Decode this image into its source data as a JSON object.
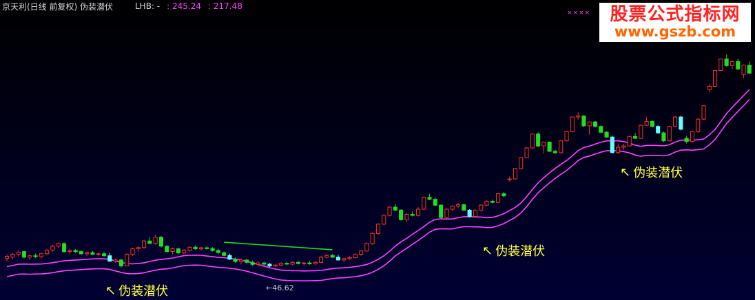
{
  "header": {
    "title": "京天利(日线 前复权) 伪装潜伏",
    "indicator_label": "LHB: -",
    "value1": ": 245.24",
    "value2": ": 217.48"
  },
  "watermark": {
    "site_name": "股票公式指标网",
    "url": "www.gszb.com"
  },
  "markers": "××××",
  "annotations": [
    {
      "text": "伪装潜伏",
      "arrow": "↖"
    },
    {
      "text": "伪装潜伏",
      "arrow": "↖"
    },
    {
      "text": "伪装潜伏",
      "arrow": "↖"
    }
  ],
  "low_label": "←46.62",
  "colors": {
    "up_candle": "#ff3030",
    "down_candle": "#22dd22",
    "signal_candle": "#66ffff",
    "band_line": "#ff44ff",
    "green_line": "#22dd22",
    "annotation": "#ffff44"
  },
  "chart_data": {
    "type": "candlestick",
    "note_scale": "price",
    "price_min": 40,
    "price_max": 250,
    "candles": [
      {
        "o": 49.5,
        "h": 51.0,
        "l": 48.5,
        "c": 50.3
      },
      {
        "o": 50.0,
        "h": 51.5,
        "l": 49.2,
        "c": 51.0
      },
      {
        "o": 51.0,
        "h": 52.5,
        "l": 50.3,
        "c": 51.8
      },
      {
        "o": 52.0,
        "h": 52.3,
        "l": 49.5,
        "c": 50.0
      },
      {
        "o": 50.0,
        "h": 51.0,
        "l": 49.0,
        "c": 50.5
      },
      {
        "o": 50.5,
        "h": 51.3,
        "l": 49.7,
        "c": 50.2
      },
      {
        "o": 50.2,
        "h": 51.5,
        "l": 49.5,
        "c": 51.2
      },
      {
        "o": 51.2,
        "h": 53.0,
        "l": 50.8,
        "c": 52.5
      },
      {
        "o": 52.5,
        "h": 54.5,
        "l": 52.0,
        "c": 54.0
      },
      {
        "o": 54.0,
        "h": 55.5,
        "l": 53.3,
        "c": 55.0
      },
      {
        "o": 55.0,
        "h": 55.5,
        "l": 51.5,
        "c": 52.0
      },
      {
        "o": 52.0,
        "h": 53.0,
        "l": 51.0,
        "c": 52.4
      },
      {
        "o": 52.4,
        "h": 53.0,
        "l": 51.5,
        "c": 52.0
      },
      {
        "o": 52.0,
        "h": 52.5,
        "l": 50.8,
        "c": 51.2
      },
      {
        "o": 51.2,
        "h": 52.0,
        "l": 50.5,
        "c": 51.6
      },
      {
        "o": 51.6,
        "h": 52.2,
        "l": 50.8,
        "c": 51.0
      },
      {
        "o": 51.0,
        "h": 51.6,
        "l": 50.3,
        "c": 51.2
      },
      {
        "o": 51.2,
        "h": 51.8,
        "l": 50.2,
        "c": 50.5
      },
      {
        "o": 50.5,
        "h": 51.5,
        "l": 49.8,
        "c": 48.6,
        "sig": true
      },
      {
        "o": 48.6,
        "h": 49.5,
        "l": 48.0,
        "c": 49.0
      },
      {
        "o": 49.0,
        "h": 49.5,
        "l": 46.5,
        "c": 47.0
      },
      {
        "o": 47.0,
        "h": 51.5,
        "l": 47.0,
        "c": 51.0
      },
      {
        "o": 51.0,
        "h": 53.5,
        "l": 50.5,
        "c": 53.0
      },
      {
        "o": 53.0,
        "h": 54.0,
        "l": 52.0,
        "c": 53.5
      },
      {
        "o": 53.5,
        "h": 56.5,
        "l": 53.0,
        "c": 56.0
      },
      {
        "o": 56.0,
        "h": 57.5,
        "l": 55.5,
        "c": 55.0
      },
      {
        "o": 55.0,
        "h": 58.5,
        "l": 54.5,
        "c": 57.5
      },
      {
        "o": 57.5,
        "h": 58.0,
        "l": 53.5,
        "c": 54.0
      },
      {
        "o": 54.0,
        "h": 54.5,
        "l": 51.5,
        "c": 52.0
      },
      {
        "o": 52.0,
        "h": 53.5,
        "l": 51.0,
        "c": 53.0
      },
      {
        "o": 53.0,
        "h": 53.5,
        "l": 51.0,
        "c": 51.5
      },
      {
        "o": 51.5,
        "h": 53.0,
        "l": 51.0,
        "c": 52.5
      },
      {
        "o": 52.5,
        "h": 54.0,
        "l": 52.0,
        "c": 53.6
      },
      {
        "o": 53.6,
        "h": 54.2,
        "l": 52.6,
        "c": 53.0
      },
      {
        "o": 53.0,
        "h": 53.8,
        "l": 52.3,
        "c": 53.4
      },
      {
        "o": 53.4,
        "h": 54.0,
        "l": 52.7,
        "c": 53.1
      },
      {
        "o": 53.1,
        "h": 53.6,
        "l": 52.0,
        "c": 52.4
      },
      {
        "o": 52.4,
        "h": 53.0,
        "l": 51.2,
        "c": 51.6
      },
      {
        "o": 51.6,
        "h": 52.0,
        "l": 50.3,
        "c": 50.6
      },
      {
        "o": 50.6,
        "h": 51.2,
        "l": 49.0,
        "c": 49.3,
        "sig": true
      },
      {
        "o": 49.3,
        "h": 50.0,
        "l": 48.0,
        "c": 48.5
      },
      {
        "o": 48.5,
        "h": 49.5,
        "l": 47.5,
        "c": 49.0
      },
      {
        "o": 49.0,
        "h": 49.5,
        "l": 47.8,
        "c": 48.2
      },
      {
        "o": 48.2,
        "h": 48.8,
        "l": 47.0,
        "c": 47.5
      },
      {
        "o": 47.5,
        "h": 48.5,
        "l": 46.8,
        "c": 48.0
      },
      {
        "o": 48.0,
        "h": 48.5,
        "l": 47.2,
        "c": 47.6
      },
      {
        "o": 47.6,
        "h": 48.0,
        "l": 46.6,
        "c": 47.0,
        "sig": true
      },
      {
        "o": 47.0,
        "h": 47.5,
        "l": 46.62,
        "c": 47.3
      },
      {
        "o": 47.3,
        "h": 48.2,
        "l": 47.0,
        "c": 47.9
      },
      {
        "o": 47.9,
        "h": 48.5,
        "l": 47.3,
        "c": 47.6
      },
      {
        "o": 47.6,
        "h": 48.5,
        "l": 47.2,
        "c": 48.2
      },
      {
        "o": 48.2,
        "h": 48.8,
        "l": 47.5,
        "c": 47.8
      },
      {
        "o": 47.8,
        "h": 48.4,
        "l": 47.2,
        "c": 48.0
      },
      {
        "o": 48.0,
        "h": 48.6,
        "l": 47.4,
        "c": 47.7
      },
      {
        "o": 47.7,
        "h": 48.5,
        "l": 47.3,
        "c": 48.2
      },
      {
        "o": 48.2,
        "h": 50.5,
        "l": 48.0,
        "c": 50.0
      },
      {
        "o": 50.0,
        "h": 51.0,
        "l": 49.5,
        "c": 50.6
      },
      {
        "o": 50.6,
        "h": 51.2,
        "l": 49.7,
        "c": 50.0
      },
      {
        "o": 50.0,
        "h": 50.8,
        "l": 48.8,
        "c": 49.0,
        "sig": true
      },
      {
        "o": 49.0,
        "h": 49.8,
        "l": 48.2,
        "c": 49.5
      },
      {
        "o": 49.5,
        "h": 50.3,
        "l": 49.0,
        "c": 49.8
      },
      {
        "o": 49.8,
        "h": 51.5,
        "l": 49.5,
        "c": 51.0
      },
      {
        "o": 51.0,
        "h": 52.5,
        "l": 50.5,
        "c": 52.2
      },
      {
        "o": 52.2,
        "h": 55.5,
        "l": 52.0,
        "c": 55.0
      },
      {
        "o": 55.0,
        "h": 59.5,
        "l": 54.5,
        "c": 59.0
      },
      {
        "o": 59.0,
        "h": 63.5,
        "l": 58.5,
        "c": 63.0
      },
      {
        "o": 63.0,
        "h": 67.5,
        "l": 62.5,
        "c": 67.0
      },
      {
        "o": 67.0,
        "h": 71.5,
        "l": 66.5,
        "c": 71.0
      },
      {
        "o": 71.0,
        "h": 72.5,
        "l": 69.0,
        "c": 69.5
      },
      {
        "o": 69.5,
        "h": 70.0,
        "l": 64.5,
        "c": 65.0
      },
      {
        "o": 65.0,
        "h": 68.0,
        "l": 64.0,
        "c": 67.5
      },
      {
        "o": 67.5,
        "h": 69.0,
        "l": 66.5,
        "c": 67.0
      },
      {
        "o": 67.0,
        "h": 71.0,
        "l": 66.5,
        "c": 70.0
      },
      {
        "o": 70.0,
        "h": 76.5,
        "l": 69.5,
        "c": 76.0
      },
      {
        "o": 76.0,
        "h": 78.0,
        "l": 74.5,
        "c": 75.0
      },
      {
        "o": 75.0,
        "h": 76.0,
        "l": 71.5,
        "c": 72.0
      },
      {
        "o": 72.0,
        "h": 72.5,
        "l": 65.5,
        "c": 66.0
      },
      {
        "o": 66.0,
        "h": 70.5,
        "l": 65.5,
        "c": 70.0
      },
      {
        "o": 70.0,
        "h": 72.0,
        "l": 69.0,
        "c": 71.5
      },
      {
        "o": 71.5,
        "h": 73.0,
        "l": 70.5,
        "c": 72.2
      },
      {
        "o": 72.2,
        "h": 72.8,
        "l": 69.0,
        "c": 69.5
      },
      {
        "o": 69.5,
        "h": 70.0,
        "l": 66.0,
        "c": 66.5,
        "sig": true
      },
      {
        "o": 66.5,
        "h": 70.0,
        "l": 66.0,
        "c": 69.5
      },
      {
        "o": 69.5,
        "h": 72.5,
        "l": 68.8,
        "c": 72.0
      },
      {
        "o": 72.0,
        "h": 74.5,
        "l": 71.5,
        "c": 74.0
      },
      {
        "o": 74.0,
        "h": 75.0,
        "l": 73.0,
        "c": 73.4
      },
      {
        "o": 73.4,
        "h": 78.5,
        "l": 73.0,
        "c": 78.0
      },
      {
        "o": 78.0,
        "h": 79.0,
        "l": 76.0,
        "c": 76.8
      },
      {
        "o": 86.0,
        "h": 88.0,
        "l": 85.0,
        "c": 86.5
      },
      {
        "o": 86.5,
        "h": 93.5,
        "l": 86.0,
        "c": 93.0
      },
      {
        "o": 93.0,
        "h": 101.0,
        "l": 92.5,
        "c": 100.5
      },
      {
        "o": 100.5,
        "h": 108.0,
        "l": 100.0,
        "c": 107.5
      },
      {
        "o": 107.5,
        "h": 119.0,
        "l": 107.0,
        "c": 118.5
      },
      {
        "o": 118.5,
        "h": 120.0,
        "l": 108.0,
        "c": 109.0
      },
      {
        "o": 109.0,
        "h": 112.5,
        "l": 103.5,
        "c": 112.0
      },
      {
        "o": 112.0,
        "h": 112.5,
        "l": 104.5,
        "c": 105.0
      },
      {
        "o": 105.0,
        "h": 106.0,
        "l": 103.0,
        "c": 104.0
      },
      {
        "o": 104.0,
        "h": 113.5,
        "l": 103.5,
        "c": 113.0
      },
      {
        "o": 113.0,
        "h": 121.0,
        "l": 112.5,
        "c": 120.5
      },
      {
        "o": 120.5,
        "h": 134.0,
        "l": 120.0,
        "c": 133.5
      },
      {
        "o": 133.5,
        "h": 138.0,
        "l": 131.0,
        "c": 134.5
      },
      {
        "o": 134.5,
        "h": 135.0,
        "l": 124.5,
        "c": 125.5
      },
      {
        "o": 125.5,
        "h": 129.5,
        "l": 118.0,
        "c": 129.0
      },
      {
        "o": 129.0,
        "h": 130.0,
        "l": 124.0,
        "c": 125.0
      },
      {
        "o": 125.0,
        "h": 126.0,
        "l": 119.0,
        "c": 120.0
      },
      {
        "o": 120.0,
        "h": 121.0,
        "l": 115.5,
        "c": 116.0
      },
      {
        "o": 116.0,
        "h": 117.0,
        "l": 103.5,
        "c": 104.0,
        "sig": true
      },
      {
        "o": 104.0,
        "h": 111.0,
        "l": 103.0,
        "c": 108.0
      },
      {
        "o": 108.0,
        "h": 110.5,
        "l": 106.0,
        "c": 109.0
      },
      {
        "o": 109.0,
        "h": 117.0,
        "l": 108.5,
        "c": 116.5
      },
      {
        "o": 116.5,
        "h": 119.5,
        "l": 114.5,
        "c": 115.0
      },
      {
        "o": 115.0,
        "h": 126.5,
        "l": 114.5,
        "c": 126.0
      },
      {
        "o": 126.0,
        "h": 133.5,
        "l": 125.5,
        "c": 129.5
      },
      {
        "o": 129.5,
        "h": 131.0,
        "l": 124.0,
        "c": 125.0
      },
      {
        "o": 125.0,
        "h": 126.0,
        "l": 118.5,
        "c": 119.5,
        "sig": true
      },
      {
        "o": 119.5,
        "h": 120.5,
        "l": 112.0,
        "c": 113.0
      },
      {
        "o": 113.0,
        "h": 125.5,
        "l": 112.5,
        "c": 125.0
      },
      {
        "o": 125.0,
        "h": 134.5,
        "l": 124.5,
        "c": 133.5
      },
      {
        "o": 133.5,
        "h": 135.0,
        "l": 121.5,
        "c": 122.5,
        "sig": true
      },
      {
        "o": 115.0,
        "h": 117.0,
        "l": 111.0,
        "c": 112.5
      },
      {
        "o": 112.5,
        "h": 121.0,
        "l": 111.5,
        "c": 120.5
      },
      {
        "o": 120.5,
        "h": 132.5,
        "l": 119.5,
        "c": 131.5
      },
      {
        "o": 131.5,
        "h": 145.0,
        "l": 131.0,
        "c": 144.5
      },
      {
        "o": 162.0,
        "h": 168.5,
        "l": 159.0,
        "c": 165.5
      },
      {
        "o": 165.5,
        "h": 185.5,
        "l": 165.0,
        "c": 185.0
      },
      {
        "o": 185.0,
        "h": 201.0,
        "l": 184.5,
        "c": 200.5
      },
      {
        "o": 200.5,
        "h": 207.0,
        "l": 190.0,
        "c": 191.5
      },
      {
        "o": 191.5,
        "h": 198.5,
        "l": 187.0,
        "c": 197.0
      },
      {
        "o": 197.0,
        "h": 201.0,
        "l": 185.5,
        "c": 187.0
      },
      {
        "o": 180.0,
        "h": 193.0,
        "l": 175.5,
        "c": 192.0
      },
      {
        "o": 192.0,
        "h": 197.0,
        "l": 180.5,
        "c": 181.5
      }
    ],
    "band_upper": [
      54.0,
      54.3,
      54.6,
      54.7,
      54.8,
      55.0,
      55.2,
      55.4,
      55.7,
      56.0
    ],
    "band_lower": [
      48.5,
      48.8,
      49.0,
      49.3,
      49.6,
      49.9,
      50.2,
      50.4,
      50.7,
      51.0
    ],
    "green_line": [
      60.0,
      59.8,
      59.5,
      59.2,
      58.9,
      58.6,
      58.3,
      58.0,
      57.7,
      57.4
    ]
  }
}
